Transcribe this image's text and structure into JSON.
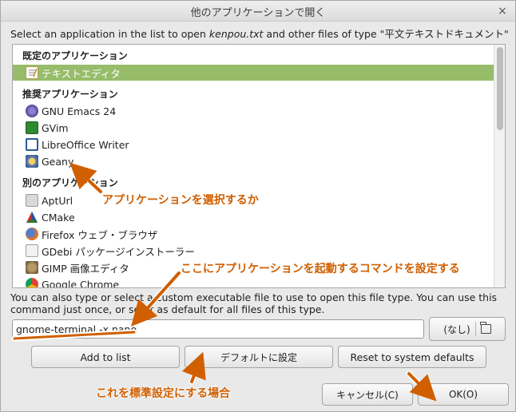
{
  "window": {
    "title": "他のアプリケーションで開く",
    "close_glyph": "×"
  },
  "prompt": {
    "before": "Select an application in the list to open ",
    "filename": "kenpou.txt",
    "after": " and other files of type \"平文テキストドキュメント\""
  },
  "list": {
    "sections": [
      {
        "label": "既定のアプリケーション"
      },
      {
        "label": "推奨アプリケーション"
      },
      {
        "label": "別のアプリケーション"
      }
    ],
    "default_apps": [
      {
        "label": "テキストエディタ",
        "icon": "text-editor-icon",
        "selected": true
      }
    ],
    "recommended_apps": [
      {
        "label": "GNU Emacs 24",
        "icon": "emacs-icon"
      },
      {
        "label": "GVim",
        "icon": "gvim-icon"
      },
      {
        "label": "LibreOffice Writer",
        "icon": "libreoffice-writer-icon"
      },
      {
        "label": "Geany",
        "icon": "geany-icon"
      }
    ],
    "other_apps": [
      {
        "label": "AptUrl",
        "icon": "apturl-icon"
      },
      {
        "label": "CMake",
        "icon": "cmake-icon"
      },
      {
        "label": "Firefox ウェブ・ブラウザ",
        "icon": "firefox-icon"
      },
      {
        "label": "GDebi パッケージインストーラー",
        "icon": "gdebi-icon"
      },
      {
        "label": "GIMP 画像エディタ",
        "icon": "gimp-icon"
      },
      {
        "label": "Google Chrome",
        "icon": "chrome-icon"
      }
    ]
  },
  "info": {
    "line1": "You can also type or select a custom executable file to use to open this file type.  You can use this",
    "line2": "command just once, or set it as default for all files of this type."
  },
  "command": {
    "value": "gnome-terminal -x nano",
    "browse_label": "(なし)"
  },
  "buttons": {
    "add": "Add to list",
    "set_default": "デフォルトに設定",
    "reset": "Reset to system defaults",
    "cancel": "キャンセル(C)",
    "ok": "OK(O)"
  },
  "annotations": {
    "select_app": "アプリケーションを選択するか",
    "set_command": "ここにアプリケーションを起動するコマンドを設定する",
    "set_default": "これを標準設定にする場合"
  },
  "colors": {
    "selection": "#97bd6b",
    "annotation": "#d05f00"
  }
}
